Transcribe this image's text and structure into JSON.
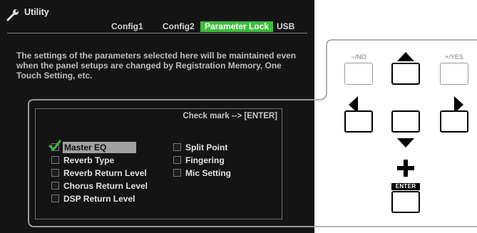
{
  "window": {
    "title": "Utility",
    "icon": "wrench-icon"
  },
  "tabs": [
    {
      "label": "Config1",
      "active": false
    },
    {
      "label": "Config2",
      "active": false
    },
    {
      "label": "Parameter Lock",
      "active": true
    },
    {
      "label": "USB",
      "active": false
    }
  ],
  "description": "The settings of the parameters selected here will be maintained even when the panel setups are changed by Registration Memory, One Touch Setting, etc.",
  "params_box": {
    "hint": "Check mark --> [ENTER]",
    "left_column": [
      {
        "label": "Master EQ",
        "checked": true,
        "selected": true
      },
      {
        "label": "Reverb Type",
        "checked": false,
        "selected": false
      },
      {
        "label": "Reverb Return Level",
        "checked": false,
        "selected": false
      },
      {
        "label": "Chorus Return Level",
        "checked": false,
        "selected": false
      },
      {
        "label": "DSP Return Level",
        "checked": false,
        "selected": false
      }
    ],
    "right_column": [
      {
        "label": "Split Point",
        "checked": false
      },
      {
        "label": "Fingering",
        "checked": false
      },
      {
        "label": "Mic Setting",
        "checked": false
      }
    ]
  },
  "panel": {
    "no_label": "−/NO",
    "yes_label": "+/YES",
    "enter_label": "ENTER"
  },
  "colors": {
    "screen_bg": "#141414",
    "active_tab": "#3dbd3d",
    "check_mark": "#3dbd3d",
    "selection_highlight": "#a0a0a0"
  }
}
